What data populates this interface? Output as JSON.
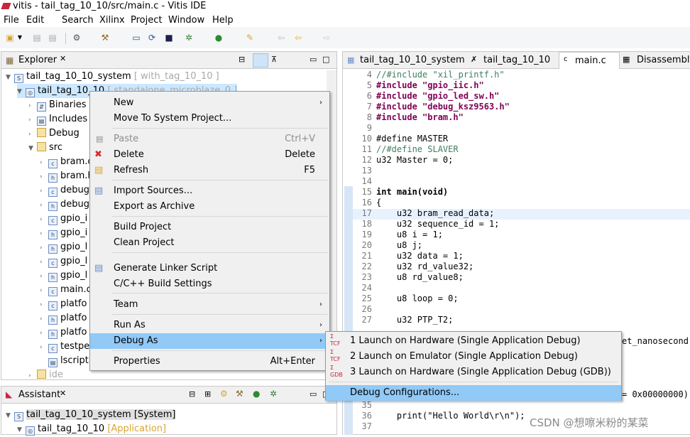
{
  "window": {
    "title": "vitis - tail_tag_10_10/src/main.c - Vitis IDE"
  },
  "menubar": [
    "File",
    "Edit",
    "Search",
    "Xilinx",
    "Project",
    "Window",
    "Help"
  ],
  "explorer": {
    "tab": "Explorer",
    "items": [
      {
        "label": "tail_tag_10_10_system",
        "suffix": " [ with_tag_10_10 ]"
      },
      {
        "label": "tail_tag_10_10",
        "suffix": " [ standalone_microblaze_0 ]"
      },
      {
        "label": "Binaries"
      },
      {
        "label": "Includes"
      },
      {
        "label": "Debug"
      },
      {
        "label": "src"
      },
      {
        "label": "bram.c"
      },
      {
        "label": "bram.h"
      },
      {
        "label": "debug"
      },
      {
        "label": "debug"
      },
      {
        "label": "gpio_i"
      },
      {
        "label": "gpio_i"
      },
      {
        "label": "gpio_l"
      },
      {
        "label": "gpio_l"
      },
      {
        "label": "gpio_l"
      },
      {
        "label": "main.c"
      },
      {
        "label": "platfo"
      },
      {
        "label": "platfo"
      },
      {
        "label": "platfo"
      },
      {
        "label": "testpe"
      },
      {
        "label": "lscript"
      },
      {
        "label": "ide"
      }
    ]
  },
  "assistant": {
    "tab": "Assistant",
    "items": [
      {
        "label": "tail_tag_10_10_system [System]"
      },
      {
        "label": "tail_tag_10_10",
        "suffix": " [Application]"
      }
    ]
  },
  "context_menu": [
    {
      "label": "New",
      "arrow": "›"
    },
    {
      "label": "Move To System Project..."
    },
    {
      "label": "Paste",
      "shortcut": "Ctrl+V",
      "disabled": true
    },
    {
      "label": "Delete",
      "shortcut": "Delete"
    },
    {
      "label": "Refresh",
      "shortcut": "F5"
    },
    {
      "label": "Import Sources..."
    },
    {
      "label": "Export as Archive"
    },
    {
      "label": "Build Project"
    },
    {
      "label": "Clean Project"
    },
    {
      "label": "Generate Linker Script"
    },
    {
      "label": "C/C++ Build Settings"
    },
    {
      "label": "Team",
      "arrow": "›"
    },
    {
      "label": "Run As",
      "arrow": "›"
    },
    {
      "label": "Debug As",
      "arrow": "›"
    },
    {
      "label": "Properties",
      "shortcut": "Alt+Enter"
    }
  ],
  "submenu": [
    {
      "label": "1 Launch on Hardware (Single Application Debug)",
      "icon": "TCF"
    },
    {
      "label": "2 Launch on Emulator (Single Application Debug)",
      "icon": "TCF"
    },
    {
      "label": "3 Launch on Hardware (Single Application Debug (GDB))",
      "icon": "GDB"
    },
    {
      "label": "Debug Configurations..."
    }
  ],
  "editor": {
    "tabs": [
      "tail_tag_10_10_system",
      "tail_tag_10_10",
      "main.c",
      "Disassembly"
    ],
    "lines": [
      {
        "n": "4",
        "t": "//#include \"xil_printf.h\""
      },
      {
        "n": "5",
        "t": "#include \"gpio_iic.h\""
      },
      {
        "n": "6",
        "t": "#include \"gpio_led_sw.h\""
      },
      {
        "n": "7",
        "t": "#include \"debug_ksz9563.h\""
      },
      {
        "n": "8",
        "t": "#include \"bram.h\""
      },
      {
        "n": "9",
        "t": ""
      },
      {
        "n": "10",
        "t": "#define MASTER"
      },
      {
        "n": "11",
        "t": "//#define SLAVER"
      },
      {
        "n": "12",
        "t": "u32 Master = 0;"
      },
      {
        "n": "13",
        "t": ""
      },
      {
        "n": "14",
        "t": ""
      },
      {
        "n": "15",
        "t": "int main(void)"
      },
      {
        "n": "16",
        "t": "{"
      },
      {
        "n": "17",
        "t": "    u32 bram_read_data;"
      },
      {
        "n": "18",
        "t": "    u32 sequence_id = 1;"
      },
      {
        "n": "19",
        "t": "    u8 i = 1;"
      },
      {
        "n": "20",
        "t": "    u8 j;"
      },
      {
        "n": "21",
        "t": "    u32 data = 1;"
      },
      {
        "n": "22",
        "t": "    u32 rd_value32;"
      },
      {
        "n": "23",
        "t": "    u8 rd_value8;"
      },
      {
        "n": "24",
        "t": ""
      },
      {
        "n": "25",
        "t": "    u8 loop = 0;"
      },
      {
        "n": "26",
        "t": ""
      },
      {
        "n": "27",
        "t": "    u32 PTP_T2;"
      }
    ],
    "right_fragments": [
      "et_nanosecond,",
      "= 0x00000000);"
    ],
    "line_36": {
      "n": "36",
      "t": "    print(\"Hello World\\r\\n\");"
    },
    "line_35": "35",
    "line_37": "37"
  },
  "watermark": "CSDN @想嚓米粉的某菜"
}
